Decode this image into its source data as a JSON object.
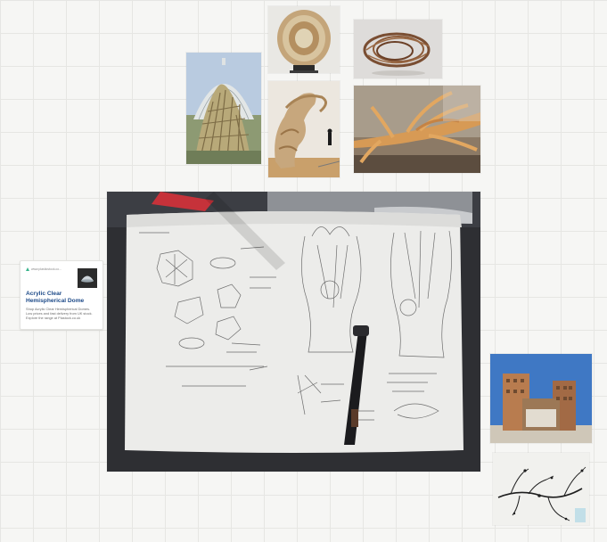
{
  "board": {
    "grid_color": "#e6e6e3",
    "background": "#f6f6f4"
  },
  "images": [
    {
      "name": "glasshouse-bamboo-installation",
      "icon": "image"
    },
    {
      "name": "woven-bamboo-disc-sculpture",
      "icon": "image"
    },
    {
      "name": "bamboo-loop-sculpture",
      "icon": "image"
    },
    {
      "name": "woven-organic-sculpture-gallery",
      "icon": "image"
    },
    {
      "name": "wooden-branch-installation",
      "icon": "image"
    },
    {
      "name": "sketchbook-photo",
      "icon": "image"
    },
    {
      "name": "brick-towers-building",
      "icon": "image"
    },
    {
      "name": "ink-branch-drawing",
      "icon": "image"
    }
  ],
  "link_card": {
    "domain": "www.plasticstock.co...",
    "title": "Acrylic Clear Hemispherical Dome",
    "description": "Shop Acrylic Clear Hemispherical Domes. Low prices and fast delivery from UK stock. Explore the range at Plastock.co.uk"
  }
}
